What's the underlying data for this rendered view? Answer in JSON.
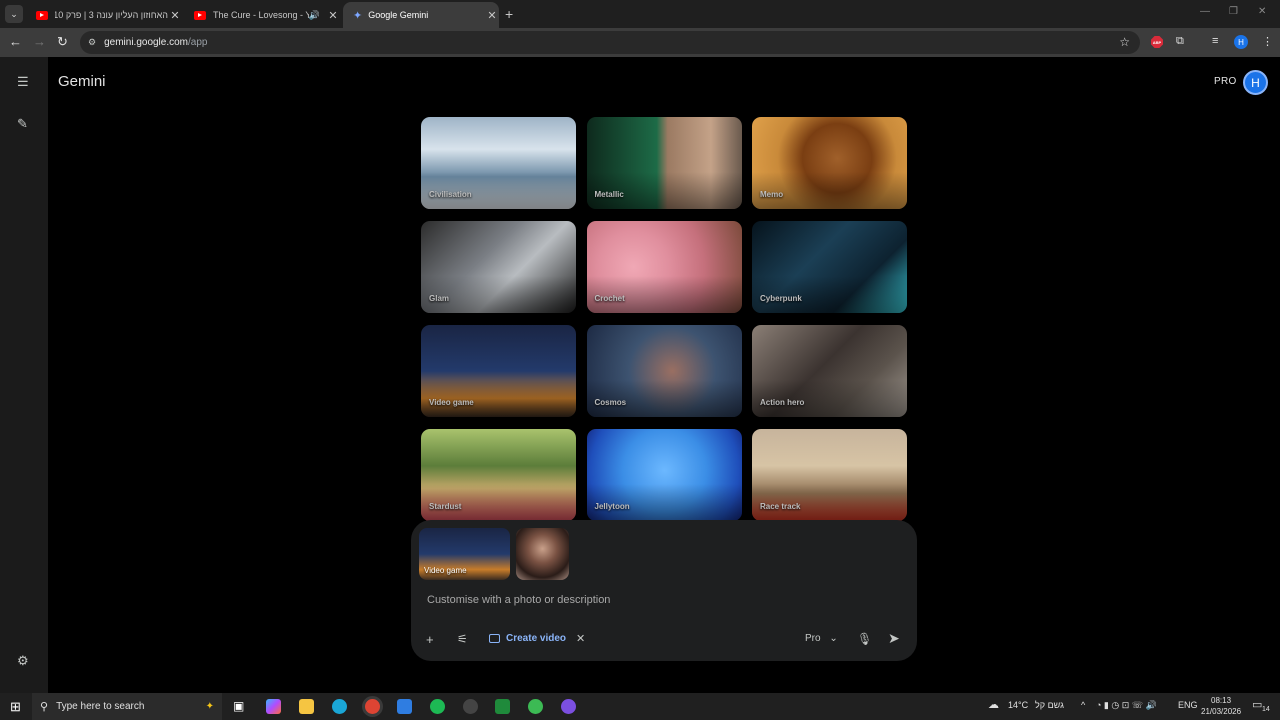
{
  "browser": {
    "tabs": [
      {
        "title": "האחוזון העליון עונה 3 | פרק 10 -"
      },
      {
        "title": "The Cure - Lovesong - YouTube"
      },
      {
        "title": "Google Gemini"
      }
    ],
    "url_host": "gemini.google.com",
    "url_path": "/app"
  },
  "app": {
    "title": "Gemini",
    "plan_badge": "PRO",
    "avatar_initial": "H"
  },
  "templates": [
    {
      "label": "Civilisation"
    },
    {
      "label": "Metallic"
    },
    {
      "label": "Memo"
    },
    {
      "label": "Glam"
    },
    {
      "label": "Crochet"
    },
    {
      "label": "Cyberpunk"
    },
    {
      "label": "Video game"
    },
    {
      "label": "Cosmos"
    },
    {
      "label": "Action hero"
    },
    {
      "label": "Stardust"
    },
    {
      "label": "Jellytoon"
    },
    {
      "label": "Race track"
    }
  ],
  "prompt": {
    "attachment_label": "Video game",
    "placeholder": "Customise with a photo or description",
    "tool_chip": "Create video",
    "model": "Pro"
  },
  "taskbar": {
    "search_placeholder": "Type here to search",
    "weather": "14°C",
    "weather_desc": "גשם קל",
    "language": "ENG",
    "time": "08:13",
    "date": "21/03/2026",
    "notif_count": "14"
  }
}
